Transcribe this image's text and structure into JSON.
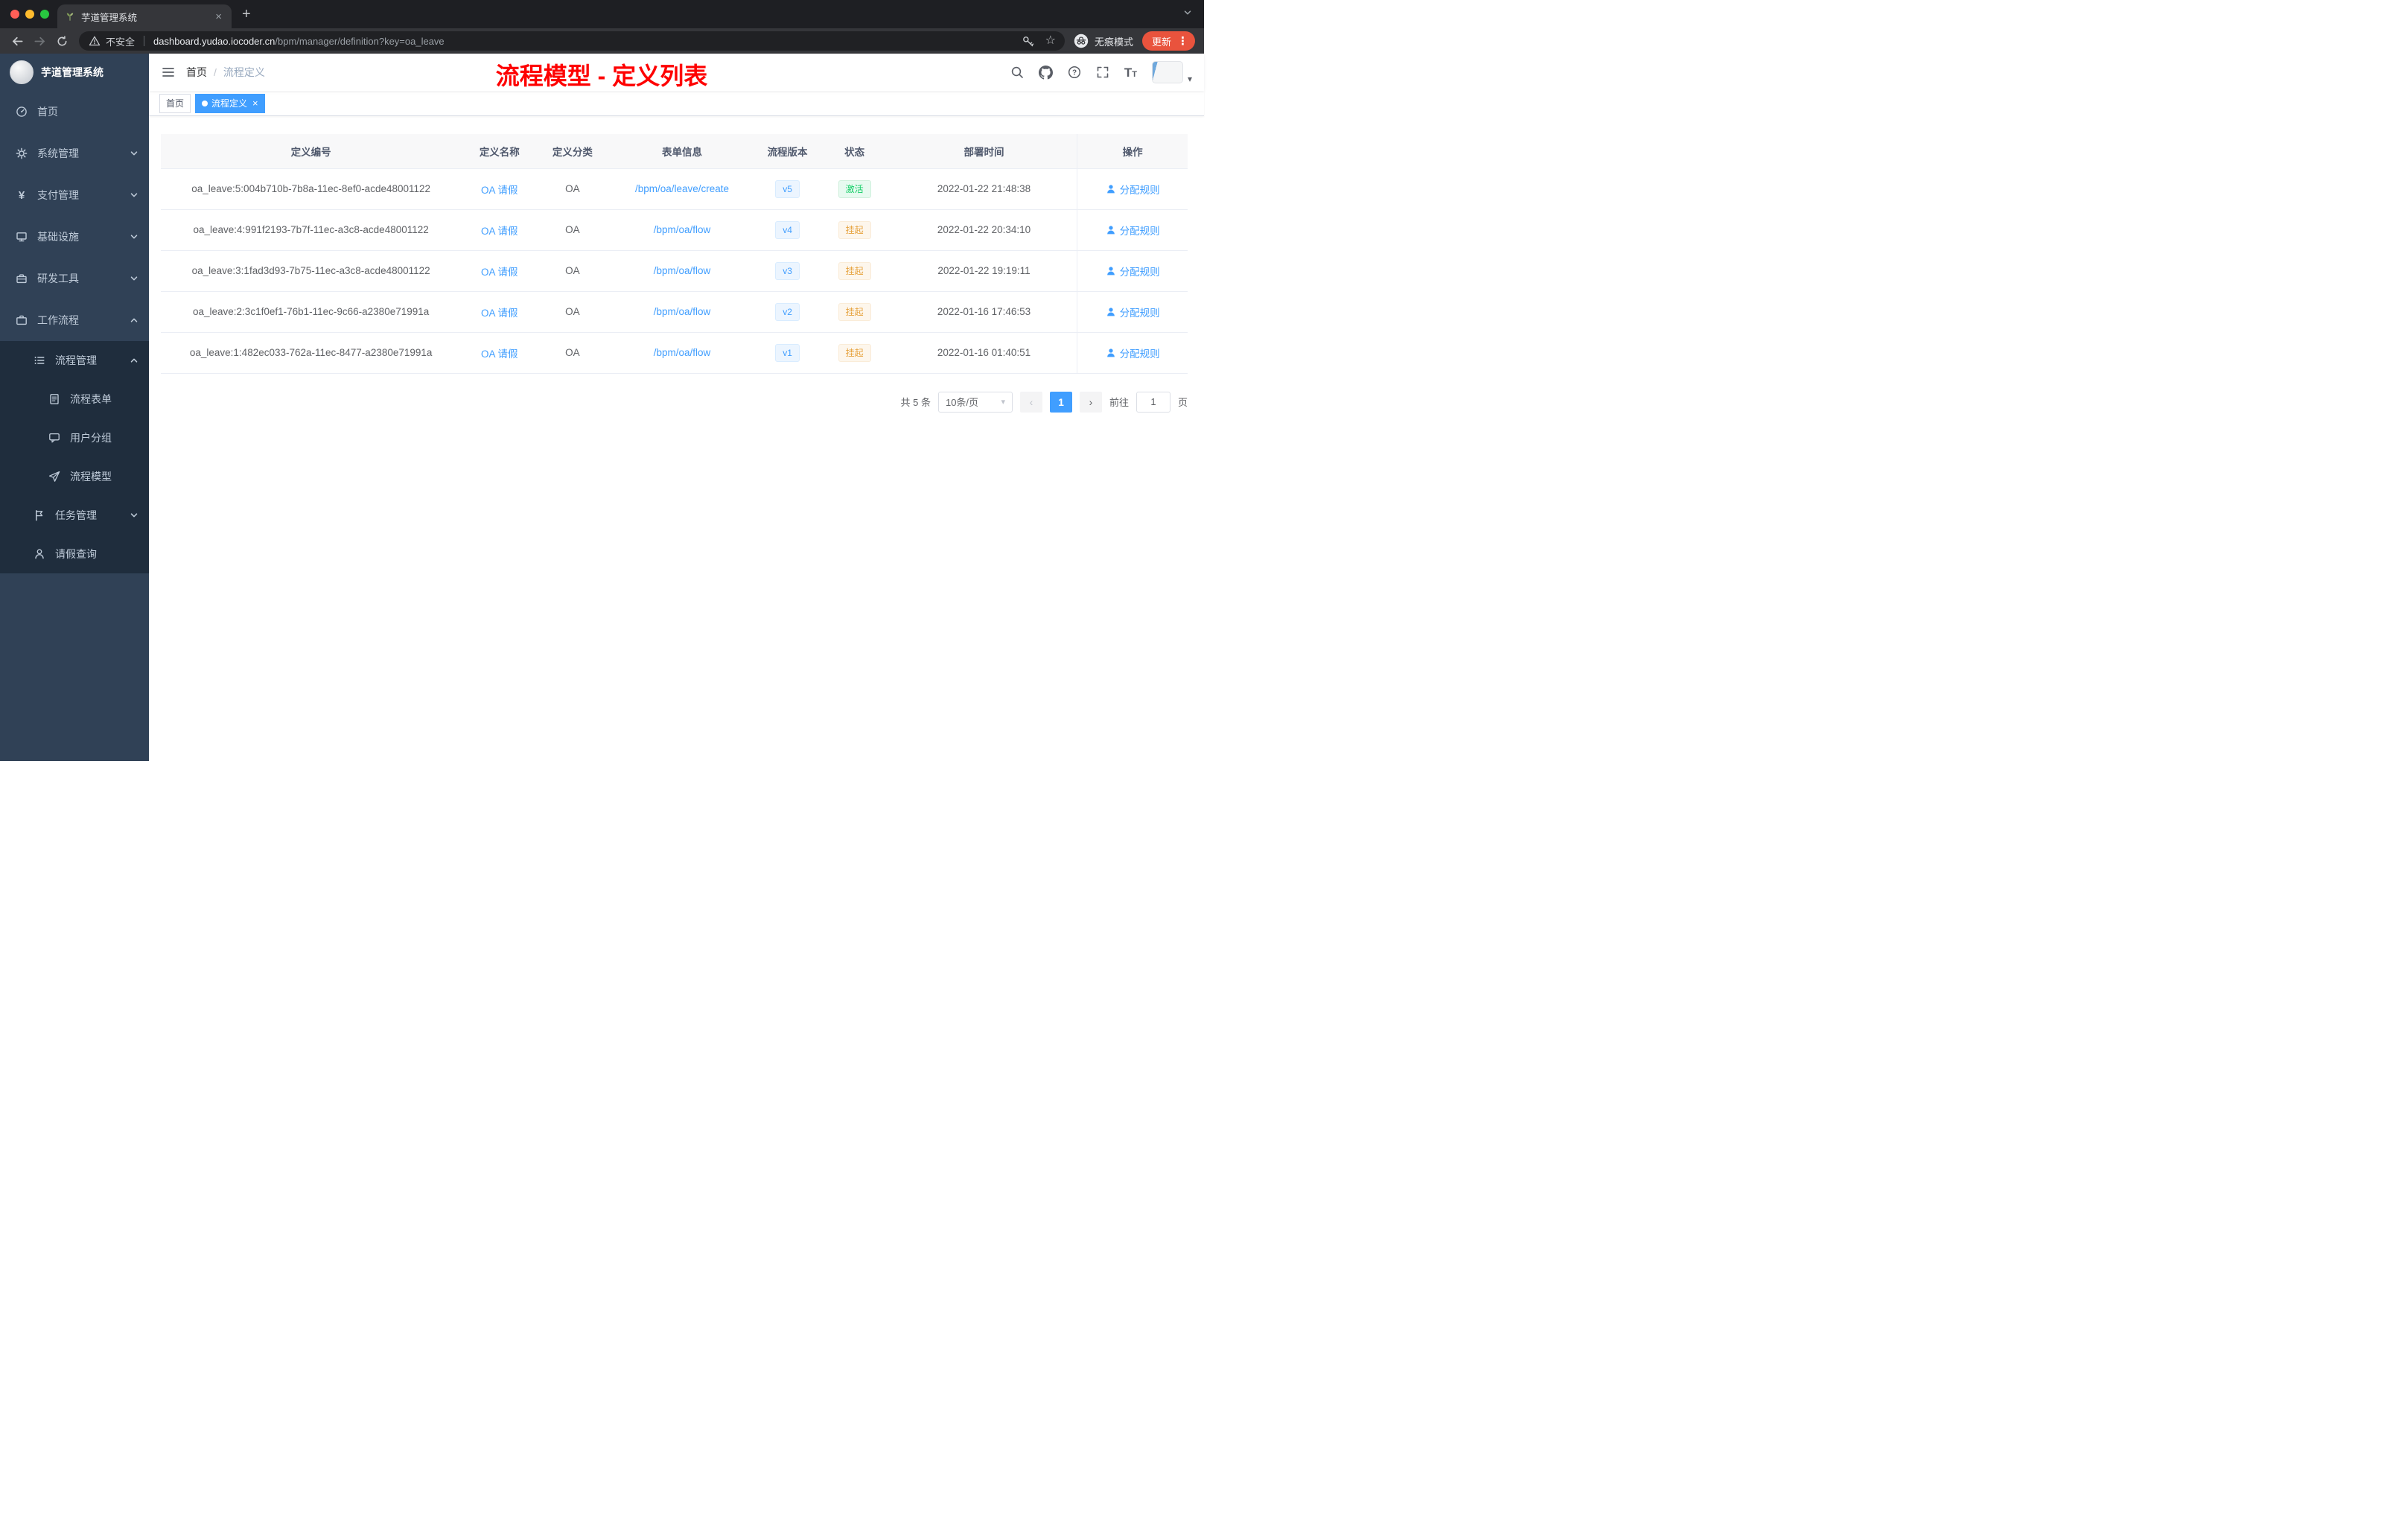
{
  "browser": {
    "tab_title": "芋道管理系统",
    "security_label": "不安全",
    "url_host": "dashboard.yudao.iocoder.cn",
    "url_path": "/bpm/manager/definition?key=oa_leave",
    "incognito_label": "无痕模式",
    "update_label": "更新"
  },
  "sidebar": {
    "logo_title": "芋道管理系统",
    "items": [
      {
        "key": "home",
        "icon": "dashboard-icon",
        "label": "首页",
        "level": 1
      },
      {
        "key": "system",
        "icon": "gear-icon",
        "label": "系统管理",
        "level": 1,
        "expandable": true
      },
      {
        "key": "payment",
        "icon": "yen-icon",
        "label": "支付管理",
        "level": 1,
        "expandable": true
      },
      {
        "key": "infrastructure",
        "icon": "infra-icon",
        "label": "基础设施",
        "level": 1,
        "expandable": true
      },
      {
        "key": "devtools",
        "icon": "tools-icon",
        "label": "研发工具",
        "level": 1,
        "expandable": true
      },
      {
        "key": "workflow",
        "icon": "workflow-icon",
        "label": "工作流程",
        "level": 1,
        "expandable": true,
        "expanded": true
      },
      {
        "key": "process-manage",
        "icon": "process-icon",
        "label": "流程管理",
        "level": 2,
        "expandable": true,
        "expanded": true,
        "nested": true
      },
      {
        "key": "process-form",
        "icon": "form-icon",
        "label": "流程表单",
        "level": 3,
        "nested": true
      },
      {
        "key": "user-group",
        "icon": "group-icon",
        "label": "用户分组",
        "level": 3,
        "nested": true
      },
      {
        "key": "process-model",
        "icon": "model-icon",
        "label": "流程模型",
        "level": 3,
        "nested": true
      },
      {
        "key": "task-manage",
        "icon": "task-icon",
        "label": "任务管理",
        "level": 2,
        "expandable": true,
        "nested": true
      },
      {
        "key": "leave-query",
        "icon": "leave-icon",
        "label": "请假查询",
        "level": 2,
        "nested": true
      }
    ]
  },
  "navbar": {
    "breadcrumb": [
      "首页",
      "流程定义"
    ],
    "overlay_title": "流程模型 - 定义列表"
  },
  "tags": [
    {
      "label": "首页",
      "active": false,
      "closable": false
    },
    {
      "label": "流程定义",
      "active": true,
      "closable": true
    }
  ],
  "table": {
    "columns": [
      "定义编号",
      "定义名称",
      "定义分类",
      "表单信息",
      "流程版本",
      "状态",
      "部署时间",
      "操作"
    ],
    "rows": [
      {
        "id": "oa_leave:5:004b710b-7b8a-11ec-8ef0-acde48001122",
        "name": "OA 请假",
        "category": "OA",
        "form": "/bpm/oa/leave/create",
        "version": "v5",
        "status": "激活",
        "status_type": "success",
        "time": "2022-01-22 21:48:38",
        "action": "分配规则"
      },
      {
        "id": "oa_leave:4:991f2193-7b7f-11ec-a3c8-acde48001122",
        "name": "OA 请假",
        "category": "OA",
        "form": "/bpm/oa/flow",
        "version": "v4",
        "status": "挂起",
        "status_type": "warning",
        "time": "2022-01-22 20:34:10",
        "action": "分配规则"
      },
      {
        "id": "oa_leave:3:1fad3d93-7b75-11ec-a3c8-acde48001122",
        "name": "OA 请假",
        "category": "OA",
        "form": "/bpm/oa/flow",
        "version": "v3",
        "status": "挂起",
        "status_type": "warning",
        "time": "2022-01-22 19:19:11",
        "action": "分配规则"
      },
      {
        "id": "oa_leave:2:3c1f0ef1-76b1-11ec-9c66-a2380e71991a",
        "name": "OA 请假",
        "category": "OA",
        "form": "/bpm/oa/flow",
        "version": "v2",
        "status": "挂起",
        "status_type": "warning",
        "time": "2022-01-16 17:46:53",
        "action": "分配规则"
      },
      {
        "id": "oa_leave:1:482ec033-762a-11ec-8477-a2380e71991a",
        "name": "OA 请假",
        "category": "OA",
        "form": "/bpm/oa/flow",
        "version": "v1",
        "status": "挂起",
        "status_type": "warning",
        "time": "2022-01-16 01:40:51",
        "action": "分配规则"
      }
    ]
  },
  "pagination": {
    "total_label": "共 5 条",
    "page_size_label": "10条/页",
    "current_page": "1",
    "goto_label": "前往",
    "goto_value": "1",
    "goto_suffix": "页"
  },
  "colors": {
    "accent_blue": "#409eff",
    "overlay_title_red": "#fe0000",
    "status_active_green": "#13ce66",
    "status_suspend_orange": "#e6a23c",
    "sidebar_bg": "#304156",
    "sidebar_nested_bg": "#1f2d3d"
  }
}
